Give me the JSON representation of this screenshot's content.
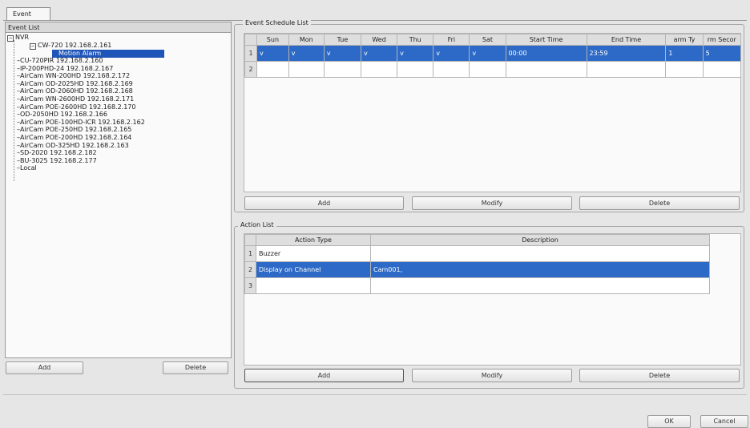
{
  "tab": "Event",
  "event_list": {
    "header": "Event List",
    "root": "NVR",
    "camera": "CW-720 192.168.2.161",
    "selected_event": "Motion Alarm",
    "devices": [
      "CU-720PIR 192.168.2.160",
      "IP-200PHD-24 192.168.2.167",
      "AirCam WN-200HD 192.168.2.172",
      "AirCam OD-2025HD 192.168.2.169",
      "AirCam OD-2060HD 192.168.2.168",
      "AirCam WN-2600HD 192.168.2.171",
      "AirCam POE-2600HD 192.168.2.170",
      "OD-2050HD 192.168.2.166",
      "AirCam POE-100HD-ICR 192.168.2.162",
      "AirCam POE-250HD 192.168.2.165",
      "AirCam POE-200HD 192.168.2.164",
      "AirCam OD-325HD 192.168.2.163",
      "SD-2020 192.168.2.182",
      "BU-3025 192.168.2.177",
      "Local"
    ],
    "add_label": "Add",
    "delete_label": "Delete"
  },
  "schedule": {
    "title": "Event Schedule List",
    "columns": [
      "Sun",
      "Mon",
      "Tue",
      "Wed",
      "Thu",
      "Fri",
      "Sat",
      "Start Time",
      "End Time",
      "arm Ty",
      "rm Secor"
    ],
    "rows": [
      {
        "n": "1",
        "cells": [
          "v",
          "v",
          "v",
          "v",
          "v",
          "v",
          "v",
          "00:00",
          "23:59",
          "1",
          "5"
        ]
      },
      {
        "n": "2",
        "cells": [
          "",
          "",
          "",
          "",
          "",
          "",
          "",
          "",
          "",
          "",
          ""
        ]
      }
    ],
    "add_label": "Add",
    "modify_label": "Modify",
    "delete_label": "Delete"
  },
  "actions": {
    "title": "Action List",
    "columns": [
      "Action Type",
      "Description"
    ],
    "rows": [
      {
        "n": "1",
        "type": "Buzzer",
        "desc": ""
      },
      {
        "n": "2",
        "type": "Display on Channel",
        "desc": "Cam001,"
      },
      {
        "n": "3",
        "type": "",
        "desc": ""
      }
    ],
    "add_label": "Add",
    "modify_label": "Modify",
    "delete_label": "Delete"
  },
  "footer": {
    "ok_label": "OK",
    "cancel_label": "Cancel"
  },
  "colors": {
    "selection": "#2d69c6",
    "tree_selection": "#1f55b8"
  }
}
